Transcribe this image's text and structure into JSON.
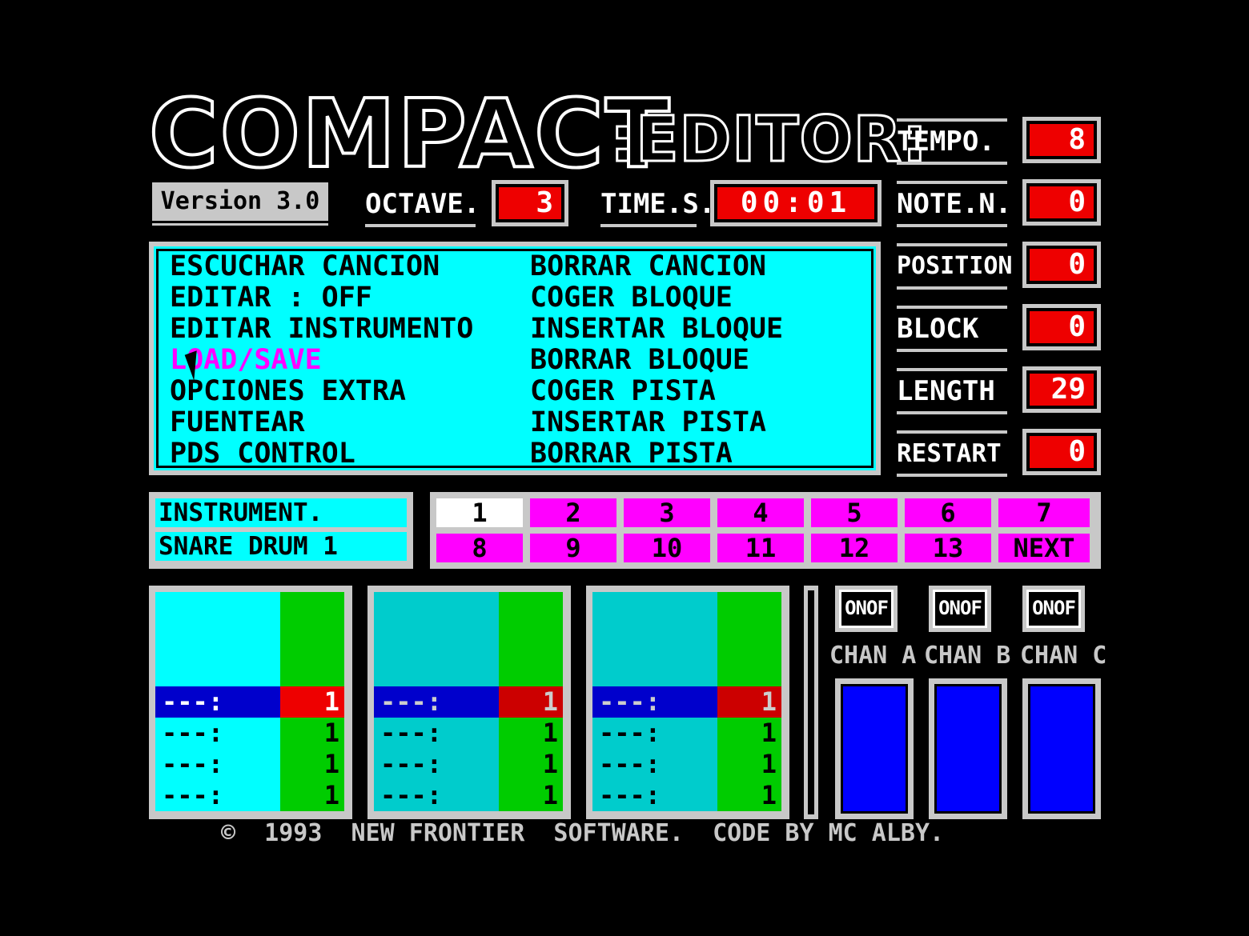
{
  "header": {
    "title_main": "COMPACT",
    "title_sub": ":EDITOR:",
    "version": "Version 3.0",
    "octave_label": "OCTAVE.",
    "octave_value": "3",
    "time_label": "TIME.S.",
    "time_value": "00:01"
  },
  "params": [
    {
      "label": "TEMPO.",
      "value": "8"
    },
    {
      "label": "NOTE.N.",
      "value": "0"
    },
    {
      "label": "POSITION",
      "value": "0"
    },
    {
      "label": "BLOCK",
      "value": "0"
    },
    {
      "label": "LENGTH",
      "value": "29"
    },
    {
      "label": "RESTART",
      "value": "0"
    }
  ],
  "menu": {
    "left": [
      "ESCUCHAR CANCION",
      "EDITAR : OFF",
      "EDITAR INSTRUMENTO",
      "LOAD/SAVE",
      "OPCIONES EXTRA",
      "FUENTEAR",
      "PDS CONTROL"
    ],
    "right": [
      "BORRAR CANCION",
      "COGER BLOQUE",
      "INSERTAR BLOQUE",
      "BORRAR BLOQUE",
      "COGER PISTA",
      "INSERTAR PISTA",
      "BORRAR PISTA"
    ],
    "highlight_color": "#ff00ff"
  },
  "instrument": {
    "label": "INSTRUMENT.",
    "name": "SNARE DRUM 1"
  },
  "instrument_numbers": [
    "1",
    "2",
    "3",
    "4",
    "5",
    "6",
    "7",
    "8",
    "9",
    "10",
    "11",
    "12",
    "13",
    "NEXT"
  ],
  "tracks": {
    "pattern": "---:",
    "rows": [
      "1",
      "1",
      "1",
      "1"
    ],
    "colors": {
      "a": "#00ffff",
      "b": "#00cccc",
      "c": "#00cccc"
    }
  },
  "channels": [
    {
      "toggle": "ONOF",
      "label": "CHAN A"
    },
    {
      "toggle": "ONOF",
      "label": "CHAN B"
    },
    {
      "toggle": "ONOF",
      "label": "CHAN C"
    }
  ],
  "footer": "©  1993  NEW FRONTIER  SOFTWARE.  CODE BY MC ALBY."
}
